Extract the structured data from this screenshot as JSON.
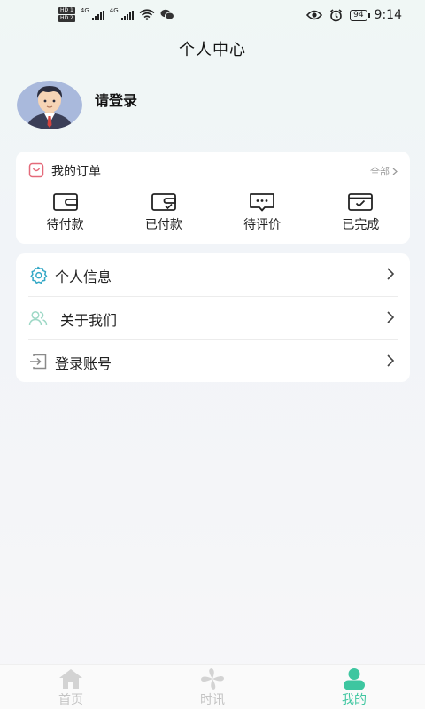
{
  "status_bar": {
    "hd1": "HD 1",
    "hd2": "HD 2",
    "net1": "4G",
    "net2": "4G",
    "battery": "94",
    "time": "9:14"
  },
  "header": {
    "title": "个人中心"
  },
  "profile": {
    "login_label": "请登录"
  },
  "orders": {
    "title": "我的订单",
    "all_label": "全部",
    "items": [
      {
        "label": "待付款",
        "icon": "wallet-icon"
      },
      {
        "label": "已付款",
        "icon": "wallet-check-icon"
      },
      {
        "label": "待评价",
        "icon": "comment-icon"
      },
      {
        "label": "已完成",
        "icon": "completed-icon"
      }
    ]
  },
  "menu": {
    "items": [
      {
        "label": "个人信息",
        "icon": "gear-icon"
      },
      {
        "label": "关于我们",
        "icon": "users-icon"
      },
      {
        "label": "登录账号",
        "icon": "login-icon"
      }
    ]
  },
  "tab_bar": {
    "tabs": [
      {
        "label": "首页",
        "icon": "home-icon",
        "active": false
      },
      {
        "label": "时讯",
        "icon": "pinwheel-icon",
        "active": false
      },
      {
        "label": "我的",
        "icon": "person-icon",
        "active": true
      }
    ]
  },
  "colors": {
    "accent": "#3ec6a0",
    "inactive": "#c4c4c4"
  }
}
